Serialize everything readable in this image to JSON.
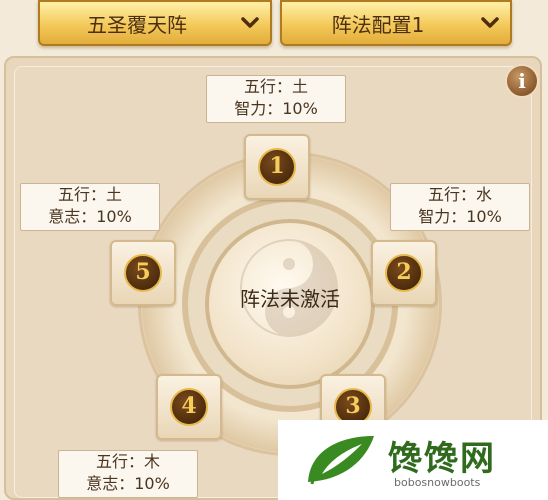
{
  "header": {
    "formation_select": "五圣覆天阵",
    "config_select": "阵法配置1"
  },
  "center": {
    "status": "阵法未激活"
  },
  "slots": [
    {
      "number": "1",
      "element": "五行：土",
      "stat": "智力：10%"
    },
    {
      "number": "2",
      "element": "五行：水",
      "stat": "智力：10%"
    },
    {
      "number": "3",
      "element": "",
      "stat": ""
    },
    {
      "number": "4",
      "element": "五行：木",
      "stat": "意志：10%"
    },
    {
      "number": "5",
      "element": "五行：土",
      "stat": "意志：10%"
    }
  ],
  "info_button": {
    "glyph": "i",
    "icon": "info-icon"
  },
  "watermark": {
    "title": "馋馋网",
    "subtitle": "bobosnowboots"
  },
  "colors": {
    "gold": "#f3c95a",
    "panel": "#e8d6bd",
    "coin": "#4a2a0c",
    "numeral": "#f6cc5a",
    "brand_green": "#2f6a1d"
  }
}
